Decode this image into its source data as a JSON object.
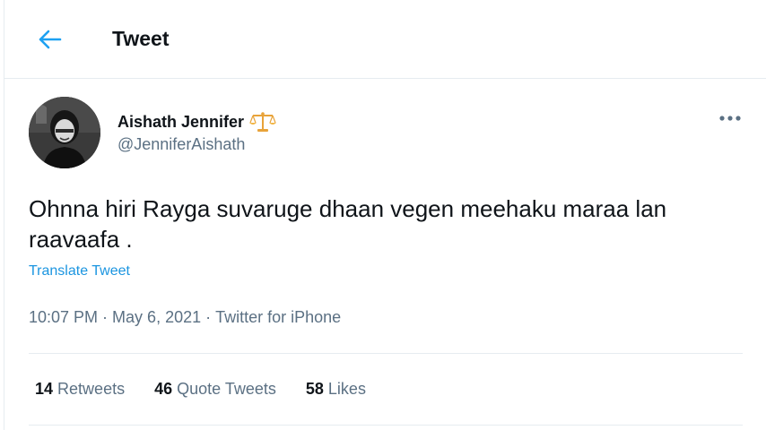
{
  "header": {
    "title": "Tweet",
    "back_icon": "arrow-left-icon",
    "accent_color": "#1da1f2"
  },
  "tweet": {
    "author": {
      "name": "Aishath Jennifer",
      "handle": "@JenniferAishath",
      "badge_icon": "scales-emoji-icon",
      "avatar_icon": "profile-photo"
    },
    "more_icon": "more-dots-icon",
    "text": "Ohnna hiri Rayga suvaruge dhaan vegen meehaku maraa lan raavaafa .",
    "translate_label": "Translate Tweet",
    "time": "10:07 PM",
    "separator": "·",
    "date": "May 6, 2021",
    "source": "Twitter for iPhone",
    "stats": {
      "retweets_count": "14",
      "retweets_label": "Retweets",
      "quotes_count": "46",
      "quotes_label": "Quote Tweets",
      "likes_count": "58",
      "likes_label": "Likes"
    }
  },
  "colors": {
    "text_primary": "#0f1419",
    "text_secondary": "#5b7083",
    "link": "#1b95e0",
    "divider": "#e6ecf0"
  }
}
